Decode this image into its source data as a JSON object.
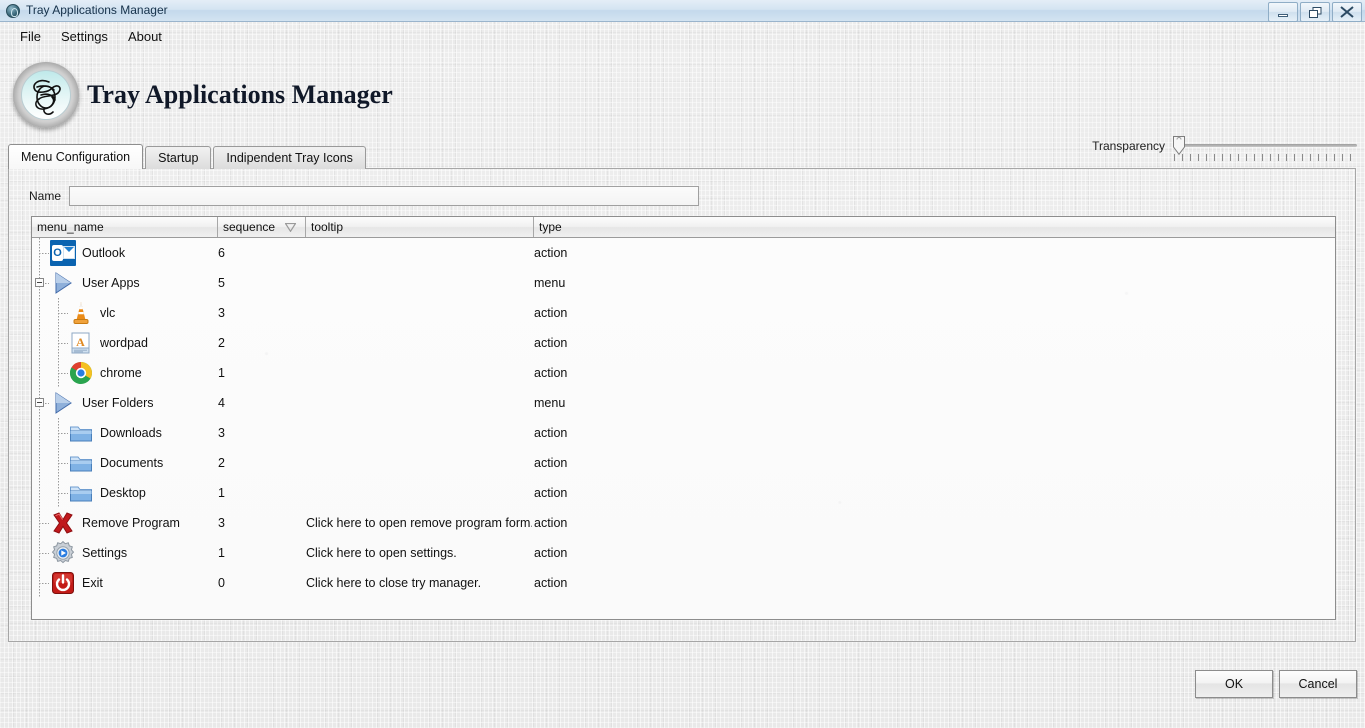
{
  "window": {
    "title": "Tray Applications Manager",
    "icon": "app-circle-icon",
    "minimize_label": "",
    "restore_label": "❐",
    "close_label": "⌧"
  },
  "menubar": {
    "items": [
      {
        "label": "File"
      },
      {
        "label": "Settings"
      },
      {
        "label": "About"
      }
    ]
  },
  "header": {
    "app_title": "Tray Applications Manager",
    "logo_icon": "monogram-badge-icon",
    "transparency_label": "Transparency",
    "transparency_value": 0
  },
  "tabs": [
    {
      "label": "Menu Configuration",
      "active": true
    },
    {
      "label": "Startup",
      "active": false
    },
    {
      "label": "Indipendent Tray Icons",
      "active": false
    }
  ],
  "form": {
    "name_label": "Name",
    "name_value": "",
    "name_placeholder": ""
  },
  "grid": {
    "columns": [
      {
        "key": "menu_name",
        "label": "menu_name",
        "sorted": false
      },
      {
        "key": "sequence",
        "label": "sequence",
        "sorted": true,
        "sort_dir": "desc"
      },
      {
        "key": "tooltip",
        "label": "tooltip",
        "sorted": false
      },
      {
        "key": "type",
        "label": "type",
        "sorted": false
      }
    ],
    "rows": [
      {
        "menu_name": "Outlook",
        "sequence": "6",
        "tooltip": "",
        "type": "action",
        "icon": "outlook-icon",
        "depth": 1,
        "expander": "none"
      },
      {
        "menu_name": "User Apps",
        "sequence": "5",
        "tooltip": "",
        "type": "menu",
        "icon": "menu-arrow-icon",
        "depth": 1,
        "expander": "collapse"
      },
      {
        "menu_name": "vlc",
        "sequence": "3",
        "tooltip": "",
        "type": "action",
        "icon": "vlc-cone-icon",
        "depth": 2,
        "expander": "none"
      },
      {
        "menu_name": "wordpad",
        "sequence": "2",
        "tooltip": "",
        "type": "action",
        "icon": "wordpad-icon",
        "depth": 2,
        "expander": "none"
      },
      {
        "menu_name": "chrome",
        "sequence": "1",
        "tooltip": "",
        "type": "action",
        "icon": "chrome-icon",
        "depth": 2,
        "expander": "none"
      },
      {
        "menu_name": "User Folders",
        "sequence": "4",
        "tooltip": "",
        "type": "menu",
        "icon": "menu-arrow-icon",
        "depth": 1,
        "expander": "collapse"
      },
      {
        "menu_name": "Downloads",
        "sequence": "3",
        "tooltip": "",
        "type": "action",
        "icon": "folder-icon",
        "depth": 2,
        "expander": "none"
      },
      {
        "menu_name": "Documents",
        "sequence": "2",
        "tooltip": "",
        "type": "action",
        "icon": "folder-icon",
        "depth": 2,
        "expander": "none"
      },
      {
        "menu_name": "Desktop",
        "sequence": "1",
        "tooltip": "",
        "type": "action",
        "icon": "folder-icon",
        "depth": 2,
        "expander": "none"
      },
      {
        "menu_name": "Remove Program",
        "sequence": "3",
        "tooltip": "Click here to open remove program form.",
        "type": "action",
        "icon": "red-x-icon",
        "depth": 1,
        "expander": "none"
      },
      {
        "menu_name": "Settings",
        "sequence": "1",
        "tooltip": "Click here to open settings.",
        "type": "action",
        "icon": "gear-icon",
        "depth": 1,
        "expander": "none"
      },
      {
        "menu_name": "Exit",
        "sequence": "0",
        "tooltip": "Click here to close try manager.",
        "type": "action",
        "icon": "power-icon",
        "depth": 1,
        "expander": "none"
      }
    ]
  },
  "footer": {
    "ok_label": "OK",
    "cancel_label": "Cancel"
  },
  "colors": {
    "titlebar_blue": "#c4d9ec",
    "outlook_blue": "#0a63b0",
    "chrome_red": "#e0402f",
    "chrome_green": "#2aa44f",
    "chrome_yellow": "#f5c022",
    "chrome_blue": "#2a7de1",
    "vlc_orange": "#eb8b17",
    "folder_blue": "#7fb2e5",
    "remove_red": "#c0181c",
    "power_red": "#c21b17",
    "menu_arrow_blue": "#5b86c4"
  }
}
